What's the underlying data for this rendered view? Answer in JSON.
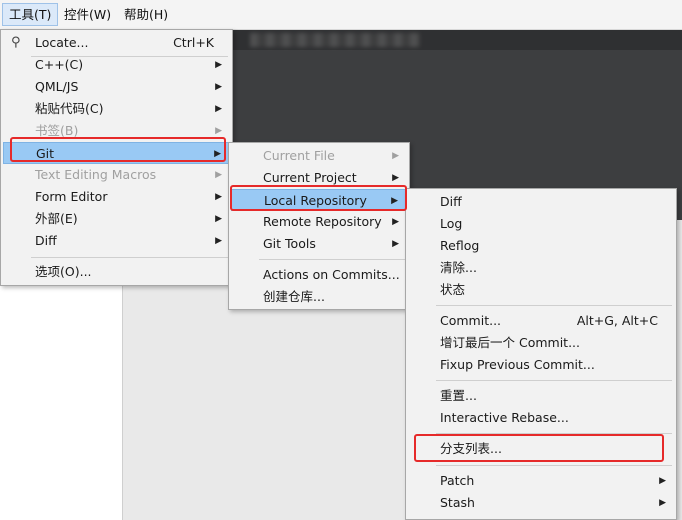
{
  "menubar": {
    "items": [
      {
        "label": "工具(T)"
      },
      {
        "label": "控件(W)"
      },
      {
        "label": "帮助(H)"
      }
    ]
  },
  "tools_menu": {
    "items": [
      {
        "label": "Locate...",
        "shortcut": "Ctrl+K"
      },
      {
        "label": "C++(C)"
      },
      {
        "label": "QML/JS"
      },
      {
        "label": "粘贴代码(C)"
      },
      {
        "label": "书签(B)"
      },
      {
        "label": "Git"
      },
      {
        "label": "Text Editing Macros"
      },
      {
        "label": "Form Editor"
      },
      {
        "label": "外部(E)"
      },
      {
        "label": "Diff"
      },
      {
        "label": "选项(O)..."
      }
    ]
  },
  "git_menu": {
    "items": [
      {
        "label": "Current File"
      },
      {
        "label": "Current Project"
      },
      {
        "label": "Local Repository"
      },
      {
        "label": "Remote Repository"
      },
      {
        "label": "Git Tools"
      },
      {
        "label": "Actions on Commits..."
      },
      {
        "label": "创建仓库..."
      }
    ]
  },
  "local_repo_menu": {
    "items": [
      {
        "label": "Diff"
      },
      {
        "label": "Log"
      },
      {
        "label": "Reflog"
      },
      {
        "label": "清除..."
      },
      {
        "label": "状态"
      },
      {
        "label": "Commit...",
        "shortcut": "Alt+G, Alt+C"
      },
      {
        "label": "增订最后一个 Commit..."
      },
      {
        "label": "Fixup Previous Commit..."
      },
      {
        "label": "重置..."
      },
      {
        "label": "Interactive Rebase..."
      },
      {
        "label": "分支列表..."
      },
      {
        "label": "Patch"
      },
      {
        "label": "Stash"
      }
    ]
  },
  "colors": {
    "highlight": "#99c9f4",
    "callout": "#e62a2a",
    "editor_bg": "#3d3e40"
  }
}
